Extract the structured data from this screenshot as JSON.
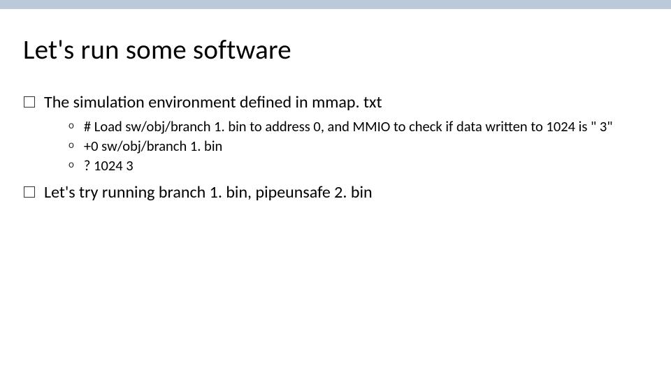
{
  "slide": {
    "title": "Let's run some software",
    "bullets": [
      {
        "text": "The simulation environment defined in mmap. txt",
        "sub": [
          "# Load sw/obj/branch 1. bin to address 0, and MMIO to check if data written to 1024 is \" 3\"",
          "+0 sw/obj/branch 1. bin",
          "? 1024 3"
        ]
      },
      {
        "text": "Let's try running branch 1. bin, pipeunsafe 2. bin",
        "sub": []
      }
    ]
  }
}
